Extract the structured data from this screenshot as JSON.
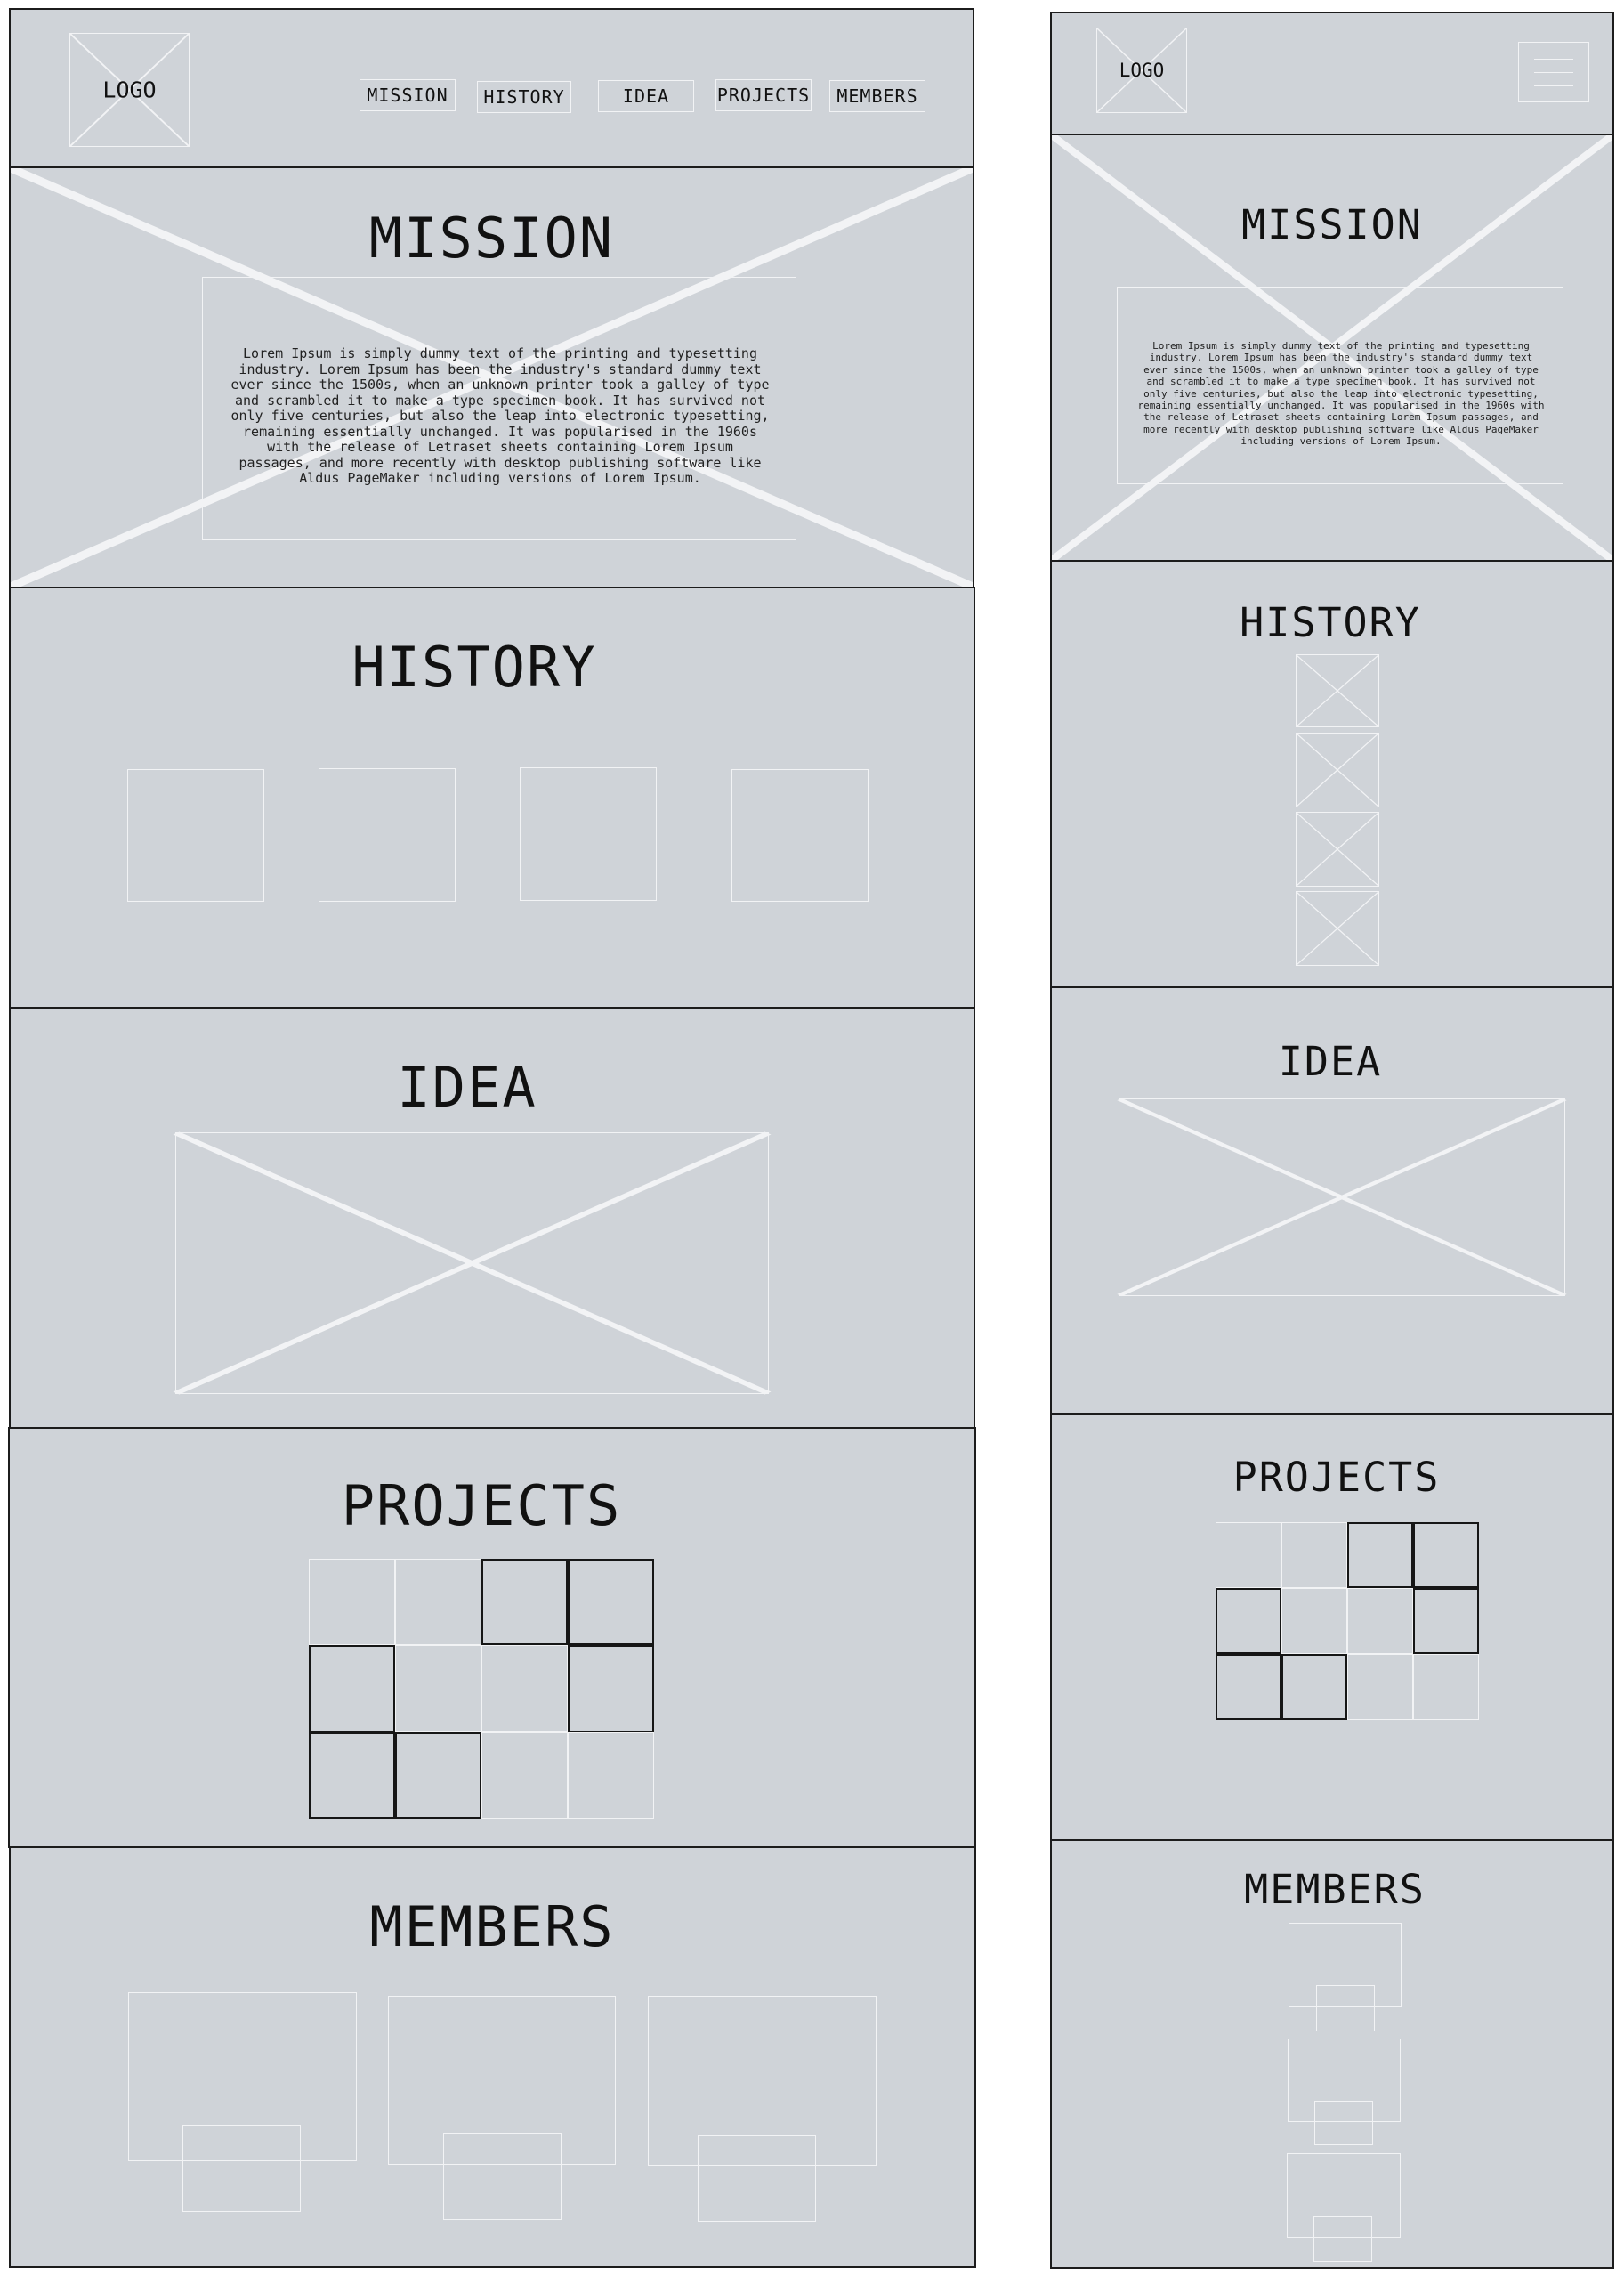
{
  "header": {
    "logo_label": "LOGO",
    "nav": [
      "MISSION",
      "HISTORY",
      "IDEA",
      "PROJECTS",
      "MEMBERS"
    ]
  },
  "sections": {
    "mission": {
      "title": "MISSION",
      "body": "Lorem Ipsum is simply dummy text of the printing and typesetting industry. Lorem Ipsum has been the industry's standard dummy text ever since the 1500s, when an unknown printer took a galley of type and scrambled it to make a type specimen book. It has survived not only five centuries, but also the leap into electronic typesetting, remaining essentially unchanged. It was popularised in the 1960s with the release of Letraset sheets containing Lorem Ipsum passages, and more recently with desktop publishing software like Aldus PageMaker including versions of Lorem Ipsum."
    },
    "history": {
      "title": "HISTORY"
    },
    "idea": {
      "title": "IDEA"
    },
    "projects": {
      "title": "PROJECTS",
      "desktop_grid_dark": [
        [
          0,
          0,
          1,
          1
        ],
        [
          1,
          0,
          0,
          1
        ],
        [
          1,
          1,
          0,
          0
        ]
      ],
      "mobile_grid_dark": [
        [
          0,
          0,
          1,
          1
        ],
        [
          1,
          0,
          0,
          1
        ],
        [
          1,
          1,
          0,
          0
        ]
      ]
    },
    "members": {
      "title": "MEMBERS"
    }
  }
}
